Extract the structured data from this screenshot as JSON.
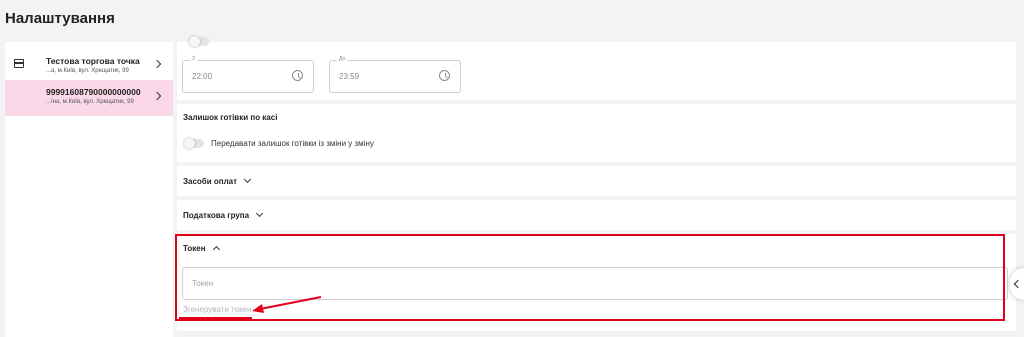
{
  "header": {
    "title": "Налаштування"
  },
  "stores": [
    {
      "name": "Тестова торгова точка",
      "address": "...а, м.Київ, вул. Хрещатик, 99"
    },
    {
      "name": "99991608790000000000",
      "address": "...їна, м.Київ, вул. Хрещатик, 99"
    }
  ],
  "schedule": {
    "from_label": "З",
    "from_value": "22:00",
    "to_label": "До",
    "to_value": "23:59"
  },
  "cash_balance": {
    "title": "Залишок готівки по касі",
    "toggle_label": "Передавати залишок готівки із зміни у зміну"
  },
  "payment_methods": {
    "title": "Засоби оплат"
  },
  "tax_group": {
    "title": "Податкова група"
  },
  "token": {
    "title": "Токен",
    "input_placeholder": "Токен",
    "generate_link": "Згенерувати токен"
  },
  "annotation": {
    "color": "#e3001b"
  }
}
